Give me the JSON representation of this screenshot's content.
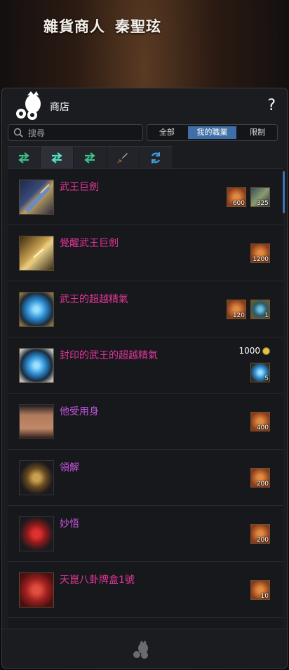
{
  "npc": {
    "role": "雜貨商人",
    "name": "秦聖玹"
  },
  "header": {
    "shop_label": "商店",
    "help_label": "?"
  },
  "search": {
    "placeholder": "搜尋"
  },
  "filters": [
    {
      "label": "全部",
      "active": false
    },
    {
      "label": "我的職業",
      "active": true
    },
    {
      "label": "限制",
      "active": false
    }
  ],
  "tabs": [
    {
      "icon": "swap-arrows-icon",
      "active": false
    },
    {
      "icon": "swap-arrows-icon",
      "active": true
    },
    {
      "icon": "swap-arrows-icon",
      "active": false
    },
    {
      "icon": "sword-icon",
      "active": false
    },
    {
      "icon": "refresh-icon",
      "active": false
    }
  ],
  "items": [
    {
      "name": "武王巨劍",
      "color": "#e0359a",
      "icon": "greatsword-icon",
      "price_text": "",
      "costs": [
        {
          "icon": "emblem-token-icon",
          "qty": "600"
        },
        {
          "icon": "ore-icon",
          "qty": "325"
        }
      ]
    },
    {
      "name": "覺醒武王巨劍",
      "color": "#e0359a",
      "icon": "awakened-greatsword-icon",
      "price_text": "",
      "costs": [
        {
          "icon": "emblem-token-icon",
          "qty": "1200"
        }
      ]
    },
    {
      "name": "武王的超越精氣",
      "color": "#e0359a",
      "icon": "blue-orb-icon",
      "price_text": "",
      "costs": [
        {
          "icon": "emblem-token-icon",
          "qty": "120"
        },
        {
          "icon": "orb-token-icon",
          "qty": "1"
        }
      ]
    },
    {
      "name": "封印的武王的超越精氣",
      "color": "#e0359a",
      "icon": "sealed-blue-orb-icon",
      "price_text": "1000",
      "costs": [
        {
          "icon": "blue-orb-icon",
          "qty": "5"
        }
      ]
    },
    {
      "name": "他受用身",
      "color": "#c455e0",
      "icon": "torso-outfit-icon",
      "price_text": "",
      "costs": [
        {
          "icon": "emblem-token-icon",
          "qty": "400"
        }
      ]
    },
    {
      "name": "領解",
      "color": "#c455e0",
      "icon": "accessory-icon",
      "price_text": "",
      "costs": [
        {
          "icon": "emblem-token-icon",
          "qty": "200"
        }
      ]
    },
    {
      "name": "妙悟",
      "color": "#c455e0",
      "icon": "red-headwear-icon",
      "price_text": "",
      "costs": [
        {
          "icon": "emblem-token-icon",
          "qty": "200"
        }
      ]
    },
    {
      "name": "天崑八卦牌盒1號",
      "color": "#e0359a",
      "icon": "red-box-icon",
      "price_text": "",
      "costs": [
        {
          "icon": "emblem-token-icon",
          "qty": "10"
        }
      ]
    }
  ]
}
